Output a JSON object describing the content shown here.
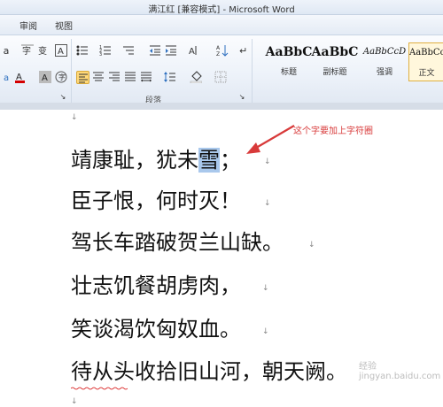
{
  "window": {
    "title": "满江红 [兼容模式] - Microsoft Word"
  },
  "tabs": [
    "审阅",
    "视图"
  ],
  "ribbon": {
    "paragraph_group_label": "段落",
    "styles": [
      {
        "sample": "AaBbC",
        "name": "标题"
      },
      {
        "sample": "AaBbC",
        "name": "副标题"
      },
      {
        "sample": "AaBbCcD",
        "name": "强调"
      },
      {
        "sample": "AaBbCc",
        "name": "正文"
      }
    ]
  },
  "document": {
    "lines": [
      {
        "before": "靖康耻，犹未",
        "highlight": "雪",
        "after": "；"
      },
      {
        "text": "臣子恨，何时灭！"
      },
      {
        "text": "驾长车踏破贺兰山缺。"
      },
      {
        "text": "壮志饥餐胡虏肉，"
      },
      {
        "text": "笑谈渴饮匈奴血。"
      },
      {
        "text": "待从头收拾旧山河，朝天阙。"
      }
    ]
  },
  "annotation": {
    "text": "这个字要加上字符圈",
    "color": "#d83a3a"
  },
  "watermark": "经验 jingyan.baidu.com",
  "colors": {
    "highlight": "#a9c8ec",
    "font_color_underline": "#d40000"
  }
}
